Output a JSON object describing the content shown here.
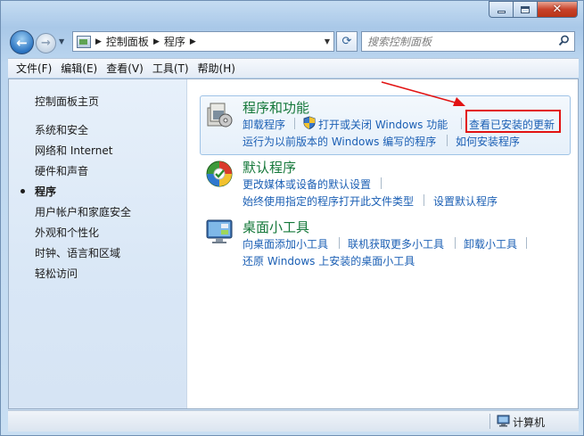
{
  "window": {
    "caption": {
      "minimize": "minimize",
      "maximize": "maximize",
      "close": "close"
    }
  },
  "nav": {
    "breadcrumb": [
      "控制面板",
      "程序"
    ],
    "search_placeholder": "搜索控制面板"
  },
  "menu": [
    "文件(F)",
    "编辑(E)",
    "查看(V)",
    "工具(T)",
    "帮助(H)"
  ],
  "sidebar": {
    "items": [
      {
        "label": "控制面板主页",
        "current": false
      },
      {
        "label": "系统和安全",
        "current": false
      },
      {
        "label": "网络和 Internet",
        "current": false
      },
      {
        "label": "硬件和声音",
        "current": false
      },
      {
        "label": "程序",
        "current": true
      },
      {
        "label": "用户帐户和家庭安全",
        "current": false
      },
      {
        "label": "外观和个性化",
        "current": false
      },
      {
        "label": "时钟、语言和区域",
        "current": false
      },
      {
        "label": "轻松访问",
        "current": false
      }
    ]
  },
  "categories": [
    {
      "title": "程序和功能",
      "icon": "programs-features-icon",
      "links": [
        "卸载程序",
        "打开或关闭 Windows 功能",
        "查看已安装的更新",
        "运行为以前版本的 Windows 编写的程序",
        "如何安装程序"
      ]
    },
    {
      "title": "默认程序",
      "icon": "default-programs-icon",
      "links": [
        "更改媒体或设备的默认设置",
        "始终使用指定的程序打开此文件类型",
        "设置默认程序"
      ]
    },
    {
      "title": "桌面小工具",
      "icon": "desktop-gadgets-icon",
      "links": [
        "向桌面添加小工具",
        "联机获取更多小工具",
        "卸载小工具",
        "还原 Windows 上安装的桌面小工具"
      ]
    }
  ],
  "status": {
    "label": "计算机"
  },
  "colors": {
    "link": "#1b5fb4",
    "title": "#15783a",
    "highlight": "#e21313"
  }
}
